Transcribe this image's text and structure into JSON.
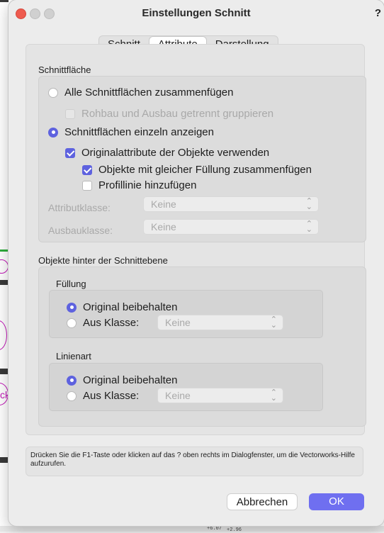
{
  "window": {
    "title": "Einstellungen Schnitt",
    "help_label": "?"
  },
  "tabs": [
    {
      "label": "Schnitt",
      "active": false
    },
    {
      "label": "Attribute",
      "active": true
    },
    {
      "label": "Darstellung",
      "active": false
    }
  ],
  "schnittflaeche": {
    "heading": "Schnittfläche",
    "option_all": {
      "label": "Alle Schnittflächen zusammenfügen",
      "selected": false
    },
    "sub_rohbau": {
      "label": "Rohbau und Ausbau getrennt gruppieren",
      "checked": false,
      "enabled": false
    },
    "option_single": {
      "label": "Schnittflächen einzeln anzeigen",
      "selected": true
    },
    "original_attr": {
      "label": "Originalattribute der Objekte verwenden",
      "checked": true
    },
    "same_fill": {
      "label": "Objekte mit gleicher Füllung zusammenfügen",
      "checked": true
    },
    "profile_line": {
      "label": "Profillinie hinzufügen",
      "checked": false
    },
    "attributklasse": {
      "label": "Attributklasse:",
      "value": "Keine"
    },
    "ausbauklasse": {
      "label": "Ausbauklasse:",
      "value": "Keine"
    }
  },
  "behind": {
    "heading": "Objekte hinter der Schnittebene",
    "fill": {
      "heading": "Füllung",
      "original": {
        "label": "Original beibehalten",
        "selected": true
      },
      "class": {
        "label": "Aus Klasse:",
        "selected": false,
        "value": "Keine"
      }
    },
    "linetype": {
      "heading": "Linienart",
      "original": {
        "label": "Original beibehalten",
        "selected": true
      },
      "class": {
        "label": "Aus Klasse:",
        "selected": false,
        "value": "Keine"
      }
    }
  },
  "info": {
    "text": "Drücken Sie die F1-Taste oder klicken auf das ? oben rechts im Dialogfenster, um die Vectorworks-Hilfe aufzurufen."
  },
  "buttons": {
    "cancel": "Abbrechen",
    "ok": "OK"
  },
  "background": {
    "cad_text": "ck",
    "cad_small_1": "+6.07",
    "cad_small_2": "+2.96"
  },
  "colors": {
    "accent": "#5e62df",
    "ok_button": "#6f6ff0",
    "close_button": "#ee5b4f"
  }
}
